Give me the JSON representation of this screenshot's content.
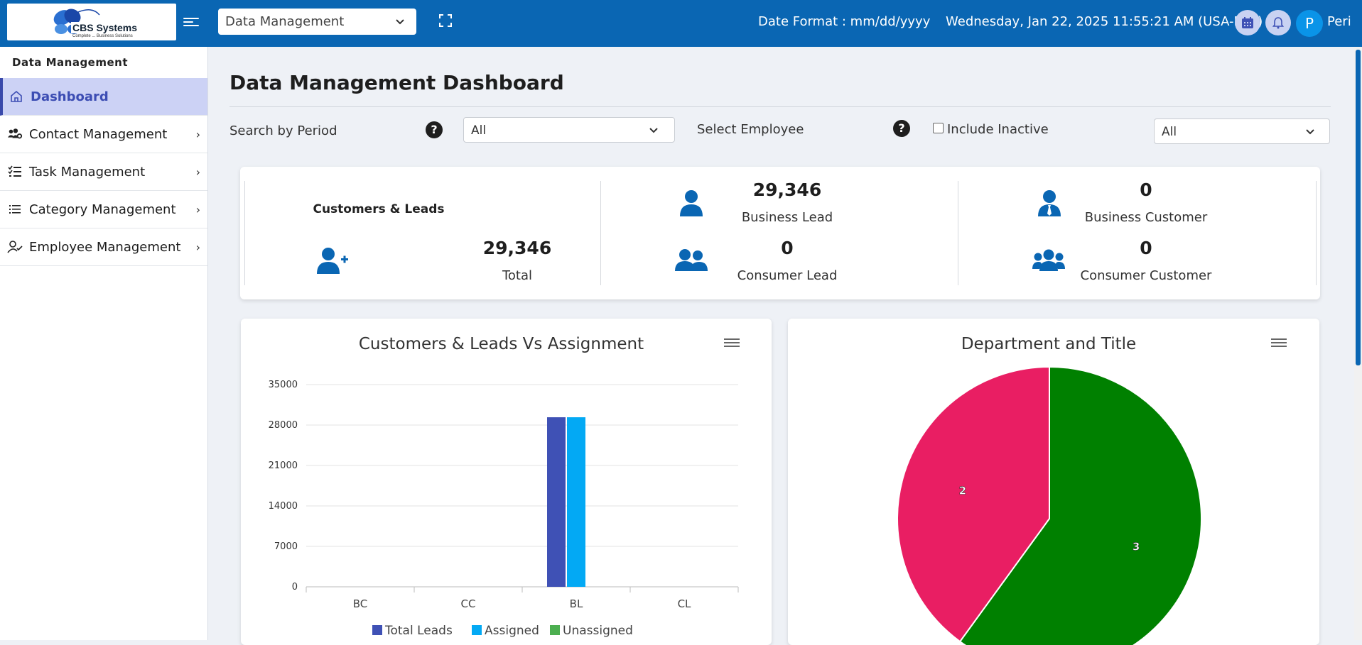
{
  "header": {
    "logo_text": "CBS Systems",
    "logo_tagline": "Complete ... Business Solutions",
    "module": "Data Management",
    "date_format": "Date Format : mm/dd/yyyy",
    "datetime": "Wednesday, Jan 22, 2025 11:55:21 AM (USA-EST)",
    "avatar_letter": "P",
    "username": "Peri"
  },
  "sidebar": {
    "title": "Data Management",
    "items": [
      {
        "label": "Dashboard",
        "icon": "home-icon"
      },
      {
        "label": "Contact Management",
        "icon": "users-cog-icon"
      },
      {
        "label": "Task Management",
        "icon": "task-list-icon"
      },
      {
        "label": "Category Management",
        "icon": "list-icon"
      },
      {
        "label": "Employee Management",
        "icon": "user-check-icon"
      }
    ]
  },
  "main": {
    "title": "Data Management Dashboard",
    "filters": {
      "period_label": "Search by Period",
      "period_value": "All",
      "employee_label": "Select Employee",
      "include_inactive_label": "Include Inactive",
      "employee_value": "All"
    },
    "stats": {
      "group_title": "Customers & Leads",
      "total_value": "29,346",
      "total_label": "Total",
      "business_lead_value": "29,346",
      "business_lead_label": "Business Lead",
      "consumer_lead_value": "0",
      "consumer_lead_label": "Consumer Lead",
      "business_customer_value": "0",
      "business_customer_label": "Business Customer",
      "consumer_customer_value": "0",
      "consumer_customer_label": "Consumer Customer"
    }
  },
  "colors": {
    "brand": "#0a66b3",
    "total_leads": "#3f51b5",
    "assigned": "#03a9f4",
    "unassigned": "#4caf50",
    "pie_a": "#e91e63",
    "pie_b": "#008000"
  },
  "chart_data": [
    {
      "type": "bar",
      "title": "Customers & Leads Vs Assignment",
      "categories": [
        "BC",
        "CC",
        "BL",
        "CL"
      ],
      "series": [
        {
          "name": "Total Leads",
          "values": [
            0,
            0,
            29346,
            0
          ]
        },
        {
          "name": "Assigned",
          "values": [
            0,
            0,
            29346,
            0
          ]
        },
        {
          "name": "Unassigned",
          "values": [
            0,
            0,
            0,
            0
          ]
        }
      ],
      "yticks": [
        0,
        7000,
        14000,
        21000,
        28000,
        35000
      ],
      "ylim": [
        0,
        35000
      ],
      "grid": true,
      "legend": "bottom"
    },
    {
      "type": "pie",
      "title": "Department and Title",
      "slices": [
        {
          "label": "2",
          "value": 2
        },
        {
          "label": "3",
          "value": 3
        }
      ]
    }
  ]
}
